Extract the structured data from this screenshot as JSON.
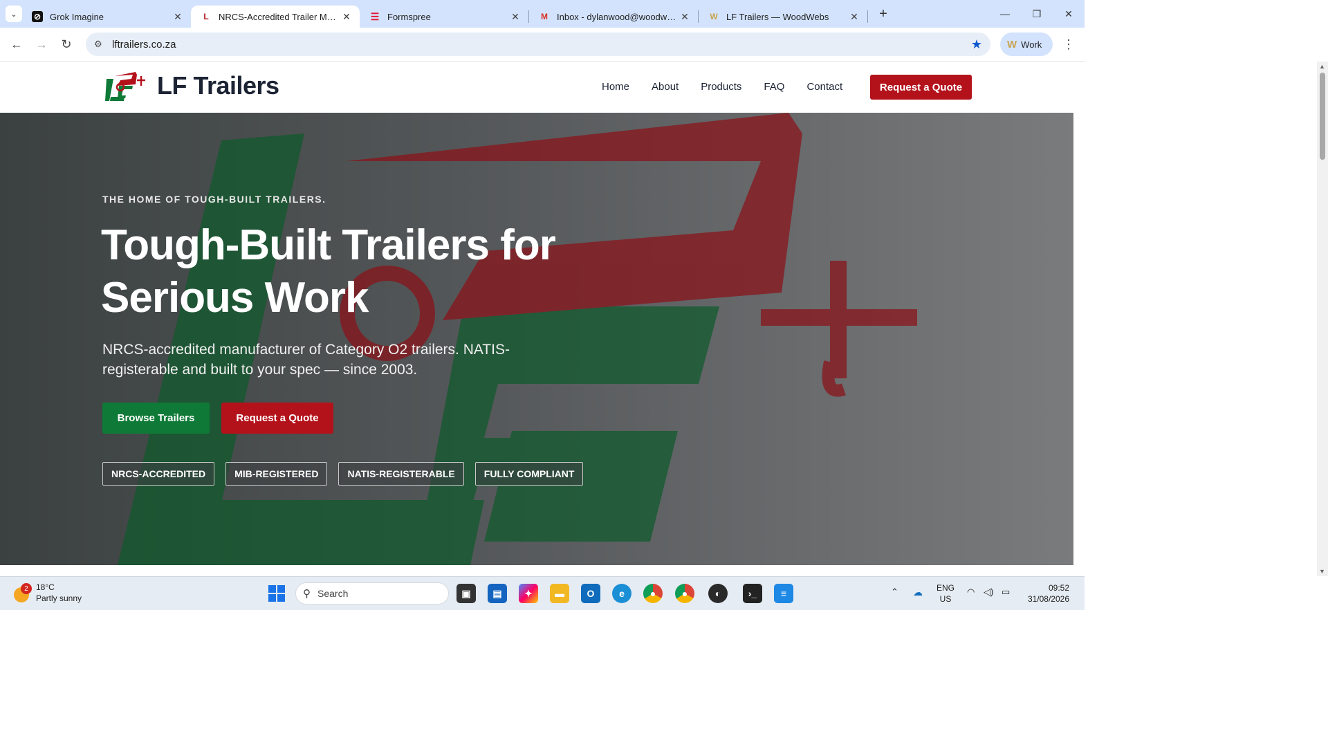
{
  "browser": {
    "tabs": [
      {
        "title": "Grok Imagine",
        "icon": "grok-icon",
        "active": false
      },
      {
        "title": "NRCS-Accredited Trailer Manufacturer",
        "icon": "lf-icon",
        "active": true
      },
      {
        "title": "Formspree",
        "icon": "formspree-icon",
        "active": false
      },
      {
        "title": "Inbox - dylanwood@woodwebs",
        "icon": "gmail-icon",
        "active": false
      },
      {
        "title": "LF Trailers — WoodWebs",
        "icon": "woodwebs-icon",
        "active": false
      }
    ],
    "url": "lftrailers.co.za",
    "profile": "Work"
  },
  "site": {
    "brand": "LF Trailers",
    "nav": [
      "Home",
      "About",
      "Products",
      "FAQ",
      "Contact"
    ],
    "cta": "Request a Quote"
  },
  "hero": {
    "eyebrow": "THE HOME OF TOUGH-BUILT TRAILERS.",
    "title": "Tough-Built Trailers for Serious Work",
    "lead": "NRCS-accredited manufacturer of Category O2 trailers. NATIS-registerable and built to your spec — since 2003.",
    "primary_button": "Browse Trailers",
    "secondary_button": "Request a Quote",
    "badges": [
      "NRCS-ACCREDITED",
      "MIB-REGISTERED",
      "NATIS-REGISTERABLE",
      "FULLY COMPLIANT"
    ]
  },
  "taskbar": {
    "weather_badge": "2",
    "temperature": "18°C",
    "condition": "Partly sunny",
    "search_placeholder": "Search",
    "lang": "ENG",
    "region": "US",
    "time": "09:52",
    "date": "31/08/2026"
  },
  "colors": {
    "brand_red": "#b4121b",
    "brand_green": "#0f7a37",
    "tab_bar": "#d3e3fd"
  }
}
